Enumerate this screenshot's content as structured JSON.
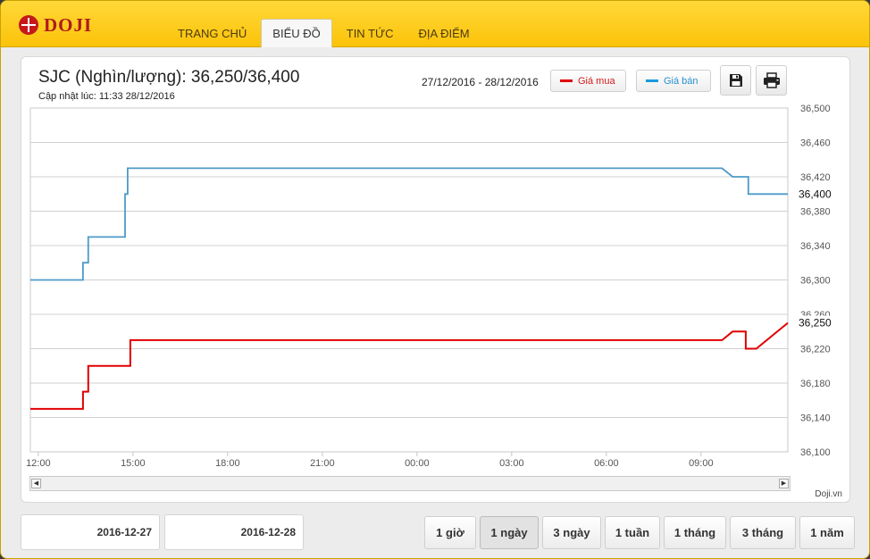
{
  "brand": {
    "name": "DOJI"
  },
  "nav": {
    "items": [
      {
        "label": "TRANG CHỦ",
        "active": false
      },
      {
        "label": "BIỂU ĐỒ",
        "active": true
      },
      {
        "label": "TIN TỨC",
        "active": false
      },
      {
        "label": "ĐỊA ĐIỂM",
        "active": false
      }
    ]
  },
  "header": {
    "title": "SJC (Nghìn/lượng): 36,250/36,400",
    "updated": "Cập nhật lúc: 11:33 28/12/2016",
    "range": "27/12/2016 - 28/12/2016"
  },
  "legend": {
    "buy_label": "Giá mua",
    "sell_label": "Giá bán"
  },
  "toolbar": {
    "save_icon": "save-icon",
    "print_icon": "print-icon"
  },
  "footer": {
    "credit": "Doji.vn",
    "date_from": "2016-12-27",
    "date_to": "2016-12-28",
    "periods": [
      {
        "label": "1 giờ",
        "active": false
      },
      {
        "label": "1 ngày",
        "active": true
      },
      {
        "label": "3 ngày",
        "active": false
      },
      {
        "label": "1 tuần",
        "active": false
      },
      {
        "label": "1 tháng",
        "active": false
      },
      {
        "label": "3 tháng",
        "active": false
      },
      {
        "label": "1 năm",
        "active": false
      }
    ]
  },
  "colors": {
    "buy": "#e00000",
    "sell": "#4d9ac8",
    "accent": "#fbc30a"
  },
  "chart_data": {
    "type": "line",
    "ylim": [
      36100,
      36500
    ],
    "y_ticks": [
      "36,100",
      "36,140",
      "36,180",
      "36,220",
      "36,260",
      "36,300",
      "36,340",
      "36,380",
      "36,420",
      "36,460",
      "36,500"
    ],
    "x_range": [
      "27/12 11:45",
      "28/12 11:45"
    ],
    "x_ticks": [
      {
        "label": "12:00",
        "t": "27/12 12:00"
      },
      {
        "label": "15:00",
        "t": "27/12 15:00"
      },
      {
        "label": "18:00",
        "t": "27/12 18:00"
      },
      {
        "label": "21:00",
        "t": "27/12 21:00"
      },
      {
        "label": "00:00",
        "t": "28/12 00:00"
      },
      {
        "label": "03:00",
        "t": "28/12 03:00"
      },
      {
        "label": "06:00",
        "t": "28/12 06:00"
      },
      {
        "label": "09:00",
        "t": "28/12 09:00"
      }
    ],
    "last_labels": {
      "sell": "36,400",
      "buy": "36,250"
    },
    "series": [
      {
        "name": "Giá bán",
        "color": "#4d9ac8",
        "points": [
          [
            "27/12 11:45",
            36300
          ],
          [
            "27/12 13:25",
            36300
          ],
          [
            "27/12 13:25",
            36320
          ],
          [
            "27/12 13:35",
            36320
          ],
          [
            "27/12 13:35",
            36350
          ],
          [
            "27/12 14:45",
            36350
          ],
          [
            "27/12 14:45",
            36400
          ],
          [
            "27/12 14:50",
            36400
          ],
          [
            "27/12 14:50",
            36430
          ],
          [
            "28/12 09:40",
            36430
          ],
          [
            "28/12 10:00",
            36420
          ],
          [
            "28/12 10:30",
            36420
          ],
          [
            "28/12 10:30",
            36400
          ],
          [
            "28/12 11:45",
            36400
          ]
        ]
      },
      {
        "name": "Giá mua",
        "color": "#e00000",
        "points": [
          [
            "27/12 11:45",
            36150
          ],
          [
            "27/12 13:25",
            36150
          ],
          [
            "27/12 13:25",
            36170
          ],
          [
            "27/12 13:35",
            36170
          ],
          [
            "27/12 13:35",
            36200
          ],
          [
            "27/12 14:55",
            36200
          ],
          [
            "27/12 14:55",
            36230
          ],
          [
            "28/12 09:40",
            36230
          ],
          [
            "28/12 10:00",
            36240
          ],
          [
            "28/12 10:25",
            36240
          ],
          [
            "28/12 10:25",
            36220
          ],
          [
            "28/12 10:45",
            36220
          ],
          [
            "28/12 11:45",
            36250
          ]
        ]
      }
    ]
  }
}
